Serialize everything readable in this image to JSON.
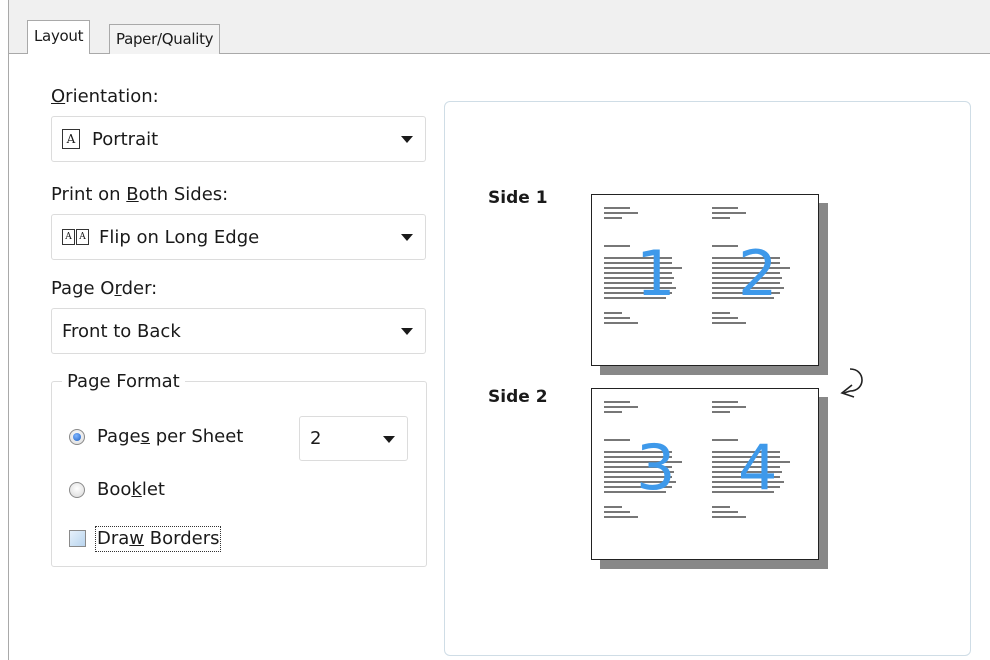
{
  "tabs": [
    {
      "label": "Layout",
      "active": true
    },
    {
      "label": "Paper/Quality",
      "active": false
    }
  ],
  "orientation": {
    "label_pre": "",
    "label_u": "O",
    "label_post": "rientation:",
    "value": "Portrait",
    "icon": "portrait-page-icon"
  },
  "duplex": {
    "label_pre": "Print on ",
    "label_u": "B",
    "label_post": "oth Sides:",
    "value": "Flip on Long Edge",
    "icon": "flip-long-edge-icon"
  },
  "page_order": {
    "label_pre": "Page O",
    "label_u": "r",
    "label_post": "der:",
    "value": "Front to Back"
  },
  "page_format": {
    "title": "Page Format",
    "pages_per_sheet": {
      "label_pre": "Page",
      "label_u": "s",
      "label_post": " per Sheet",
      "selected": true,
      "value": "2"
    },
    "booklet": {
      "label_pre": "Boo",
      "label_u": "k",
      "label_post": "let",
      "selected": false
    },
    "draw_borders": {
      "label_pre": "Dra",
      "label_u": "w",
      "label_post": " Borders",
      "checked": false
    }
  },
  "preview": {
    "side1": {
      "label": "Side 1",
      "pages": [
        "1",
        "2"
      ]
    },
    "side2": {
      "label": "Side 2",
      "pages": [
        "3",
        "4"
      ]
    }
  },
  "colors": {
    "accent_number": "#3e99ea",
    "page_shadow": "#888888"
  }
}
